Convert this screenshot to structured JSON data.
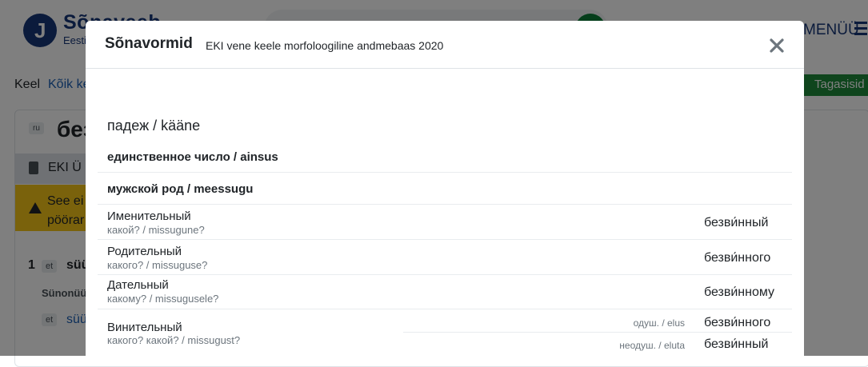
{
  "background": {
    "logo_letter": "J",
    "logo_text": "Sõnaveeb",
    "logo_sub": "Eesti",
    "menu_label": "MENÜÜ",
    "lang_label": "Keel",
    "lang_link": "Kõik ke",
    "feedback": "Tagasisid",
    "headword_lang": "ru",
    "headword": "без",
    "source_label": "EKI Ü",
    "warning_line1": "See ei",
    "warning_line2": "pöörar",
    "sense_number": "1",
    "sense_lang": "et",
    "sense_word": "süü",
    "synonyms_label": "Sünonüü",
    "syn_lang": "et",
    "syn_link": "süü"
  },
  "modal": {
    "title": "Sõnavormid",
    "subtitle": "EKI vene keele morfoloogiline andmebaas 2020",
    "case_heading": "падеж / kääne",
    "number_group": "единственное число / ainsus",
    "gender_group": "мужской род / meessugu",
    "rows": [
      {
        "case": "Именительный",
        "question": "какой? / missugune?",
        "form": "безви́нный"
      },
      {
        "case": "Родительный",
        "question": "какого? / missuguse?",
        "form": "безви́нного"
      },
      {
        "case": "Дательный",
        "question": "какому? / missugusele?",
        "form": "безви́нному"
      },
      {
        "case": "Винительный",
        "question": "какого? какой? / missugust?",
        "anim_label": "одуш. / elus",
        "anim_form": "безви́нного",
        "inanim_label": "неодуш. / eluta",
        "inanim_form": "безви́нный"
      }
    ]
  },
  "colors": {
    "brand": "#173778",
    "success": "#1f8a3b",
    "warning": "#f5c518"
  }
}
